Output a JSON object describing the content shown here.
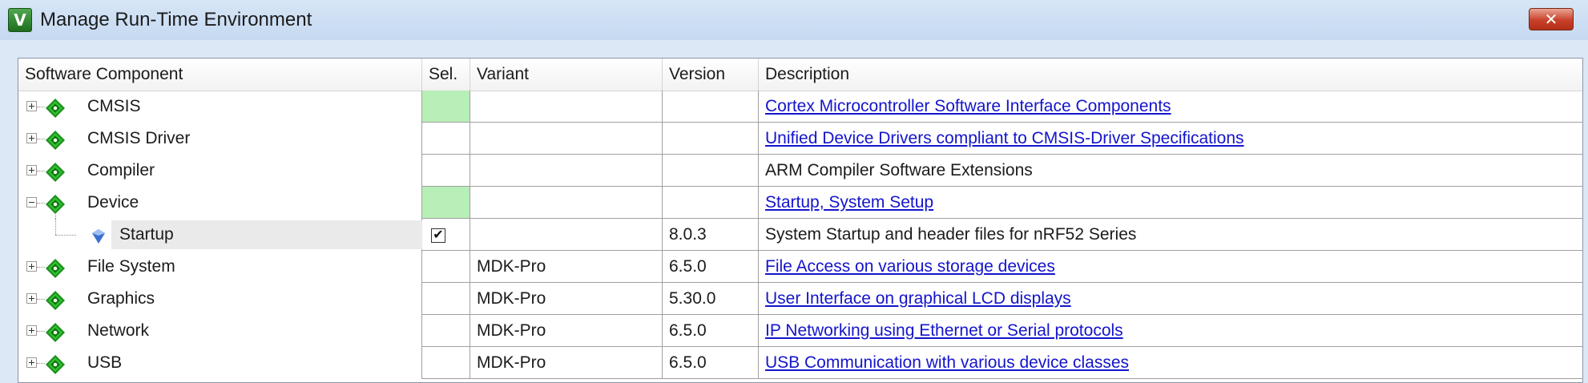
{
  "window": {
    "title": "Manage Run-Time Environment",
    "app_icon_glyph": "V",
    "close_glyph": "✕",
    "colors": {
      "selection_green": "#b8eeb8",
      "link": "#1414cc",
      "gem": "#2db52d"
    }
  },
  "columns": {
    "component": "Software Component",
    "sel": "Sel.",
    "variant": "Variant",
    "version": "Version",
    "description": "Description"
  },
  "rows": [
    {
      "name": "CMSIS",
      "icon": "component-gem-icon",
      "expand": "plus",
      "sel": "green",
      "variant": "",
      "version": "",
      "description": "Cortex Microcontroller Software Interface Components",
      "link": true
    },
    {
      "name": "CMSIS Driver",
      "icon": "component-gem-icon",
      "expand": "plus",
      "sel": "",
      "variant": "",
      "version": "",
      "description": "Unified Device Drivers compliant to CMSIS-Driver Specifications",
      "link": true
    },
    {
      "name": "Compiler",
      "icon": "component-gem-icon",
      "expand": "plus",
      "sel": "",
      "variant": "",
      "version": "",
      "description": "ARM Compiler Software Extensions",
      "link": false
    },
    {
      "name": "Device",
      "icon": "component-gem-icon",
      "expand": "minus",
      "sel": "green",
      "variant": "",
      "version": "",
      "description": "Startup, System Setup",
      "link": true
    },
    {
      "name": "Startup",
      "icon": "blue-diamond-icon",
      "expand": "none",
      "sel": "checked",
      "variant": "",
      "version": "8.0.3",
      "description": "System Startup and header files for nRF52 Series",
      "link": false
    },
    {
      "name": "File System",
      "icon": "component-gem-icon",
      "expand": "plus",
      "sel": "",
      "variant": "MDK-Pro",
      "version": "6.5.0",
      "description": "File Access on various storage devices",
      "link": true
    },
    {
      "name": "Graphics",
      "icon": "component-gem-icon",
      "expand": "plus",
      "sel": "",
      "variant": "MDK-Pro",
      "version": "5.30.0",
      "description": "User Interface on graphical LCD displays",
      "link": true
    },
    {
      "name": "Network",
      "icon": "component-gem-icon",
      "expand": "plus",
      "sel": "",
      "variant": "MDK-Pro",
      "version": "6.5.0",
      "description": "IP Networking using Ethernet or Serial protocols",
      "link": true
    },
    {
      "name": "USB",
      "icon": "component-gem-icon",
      "expand": "plus",
      "sel": "",
      "variant": "MDK-Pro",
      "version": "6.5.0",
      "description": "USB Communication with various device classes",
      "link": true
    }
  ]
}
